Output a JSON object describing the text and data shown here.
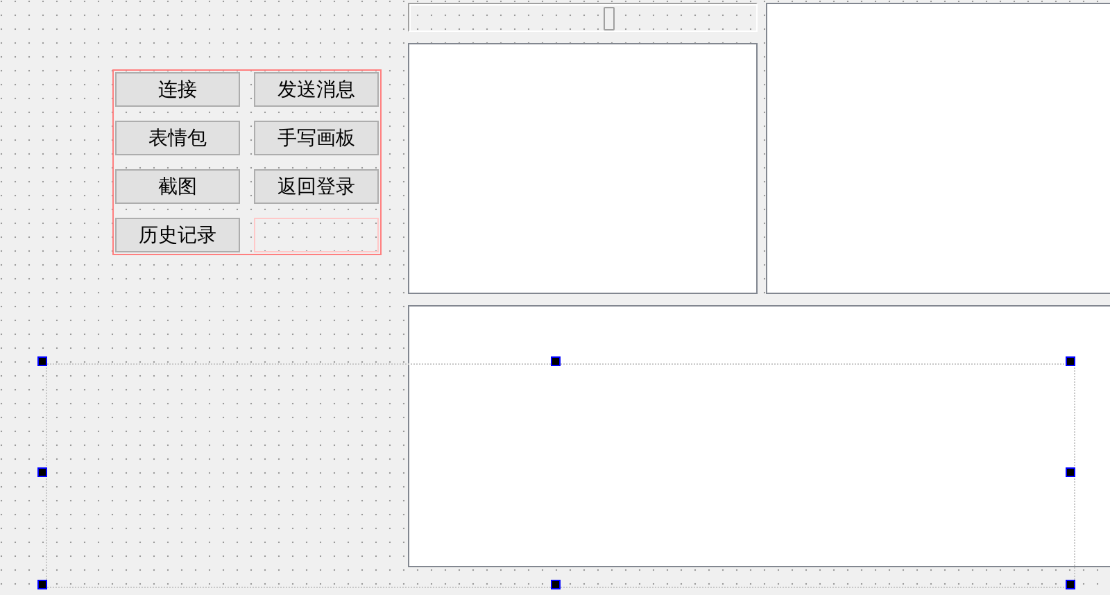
{
  "button_grid": {
    "buttons": [
      {
        "label": "连接"
      },
      {
        "label": "发送消息"
      },
      {
        "label": "表情包"
      },
      {
        "label": "手写画板"
      },
      {
        "label": "截图"
      },
      {
        "label": "返回登录"
      },
      {
        "label": "历史记录"
      }
    ]
  },
  "slider": {
    "level": 0.57
  }
}
